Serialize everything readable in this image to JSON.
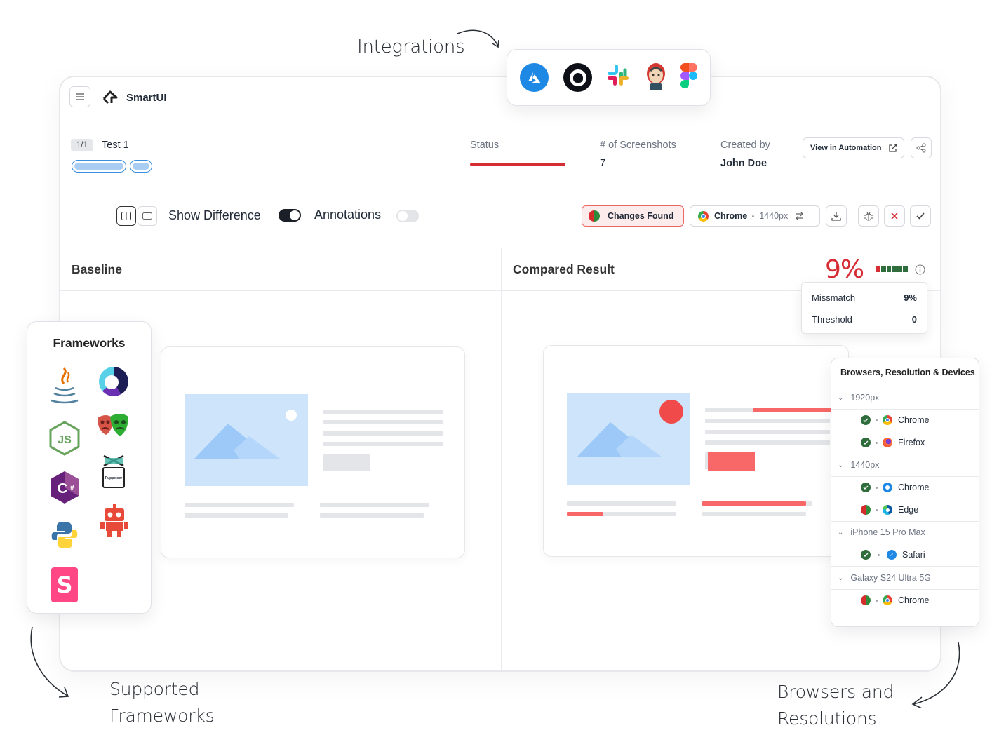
{
  "annotations": {
    "integrations": "Integrations",
    "frameworks_line1": "Supported",
    "frameworks_line2": "Frameworks",
    "browsers_line1": "Browsers and",
    "browsers_line2": "Resolutions"
  },
  "integrations": {
    "icons": [
      "azure-devops-icon",
      "github-icon",
      "slack-icon",
      "jenkins-icon",
      "figma-icon"
    ]
  },
  "header": {
    "app_name": "SmartUI"
  },
  "test": {
    "counter": "1/1",
    "name": "Test 1",
    "status_label": "Status",
    "screenshots_label": "# of Screenshots",
    "screenshots_value": "7",
    "created_label": "Created by",
    "created_value": "John Doe",
    "view_button": "View in Automation",
    "status_color": "#d62c34"
  },
  "toolbar": {
    "show_difference": "Show Difference",
    "show_difference_on": true,
    "annotations": "Annotations",
    "annotations_on": false,
    "changes_found": "Changes Found",
    "browser": "Chrome",
    "resolution": "1440px"
  },
  "compare": {
    "baseline_title": "Baseline",
    "result_title": "Compared Result",
    "mismatch_pct": "9%",
    "tooltip": {
      "mismatch_label": "Missmatch",
      "mismatch_value": "9%",
      "threshold_label": "Threshold",
      "threshold_value": "0"
    }
  },
  "frameworks": {
    "title": "Frameworks",
    "icons": [
      "java-icon",
      "cypress-icon",
      "nodejs-icon",
      "playwright-icon",
      "csharp-icon",
      "puppeteer-icon",
      "python-icon",
      "robot-framework-icon",
      "storybook-icon"
    ],
    "puppeteer_label": "Puppeteer"
  },
  "browsers_panel": {
    "title": "Browsers, Resolution & Devices",
    "groups": [
      {
        "label": "1920px",
        "items": [
          {
            "browser": "Chrome",
            "status": "pass"
          },
          {
            "browser": "Firefox",
            "status": "pass"
          }
        ]
      },
      {
        "label": "1440px",
        "items": [
          {
            "browser": "Chrome",
            "status": "pass"
          },
          {
            "browser": "Edge",
            "status": "changed"
          }
        ]
      },
      {
        "label": "iPhone 15 Pro Max",
        "items": [
          {
            "browser": "Safari",
            "status": "pass"
          }
        ]
      },
      {
        "label": "Galaxy S24 Ultra 5G",
        "items": [
          {
            "browser": "Chrome",
            "status": "changed"
          }
        ]
      }
    ]
  },
  "colors": {
    "accent_red": "#d62c34",
    "highlight_red": "#f86868",
    "image_blue": "#cde4fb",
    "mountain_blue": "#9dc9f8",
    "pass_green": "#2f6d3c"
  }
}
